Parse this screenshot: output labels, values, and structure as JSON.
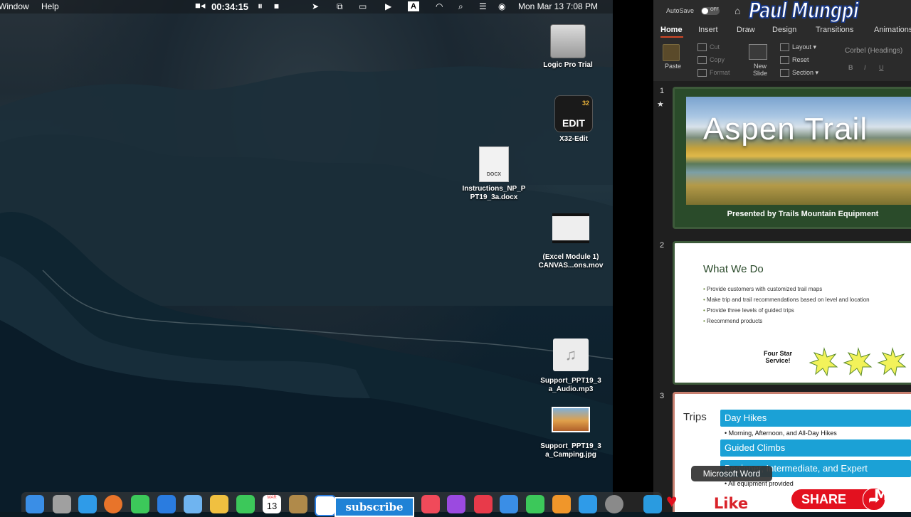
{
  "menubar": {
    "left_items": [
      "Window",
      "Help"
    ],
    "recording_time": "00:34:15",
    "datetime": "Mon Mar 13  7:08 PM",
    "input_indicator": "A"
  },
  "desktop_icons": [
    {
      "label": "Logic Pro Trial",
      "icon": "hard-drive-icon"
    },
    {
      "label": "X32-Edit",
      "icon": "x32-edit-app-icon",
      "art_text": "EDIT",
      "badge_text": "32"
    },
    {
      "label": "Instructions_NP_P\nPT19_3a.docx",
      "icon": "docx-file-icon",
      "art_text": "DOCX"
    },
    {
      "label": "(Excel Module 1)\nCANVAS...ons.mov",
      "icon": "movie-file-icon"
    },
    {
      "label": "Support_PPT19_3\na_Audio.mp3",
      "icon": "audio-file-icon"
    },
    {
      "label": "Support_PPT19_3\na_Camping.jpg",
      "icon": "image-file-icon"
    }
  ],
  "ppt": {
    "autosave_label": "AutoSave",
    "autosave_state": "OFF",
    "watermark": "Paul Mungpi",
    "tabs": [
      "Home",
      "Insert",
      "Draw",
      "Design",
      "Transitions",
      "Animations"
    ],
    "active_tab": "Home",
    "ribbon": {
      "paste": "Paste",
      "cut": "Cut",
      "copy": "Copy",
      "format": "Format",
      "new_slide": "New\nSlide",
      "layout": "Layout",
      "reset": "Reset",
      "section": "Section",
      "font": "Corbel (Headings)",
      "bold": "B",
      "italic": "I",
      "underline": "U"
    },
    "slides": [
      {
        "number": "1",
        "star": "★",
        "title": "Aspen Trail",
        "subtitle": "Presented by Trails Mountain Equipment"
      },
      {
        "number": "2",
        "title": "What We Do",
        "bullets": [
          "Provide customers with customized trail maps",
          "Make trip and trail recommendations based on level and location",
          "Provide three levels of guided trips",
          "Recommend products"
        ],
        "callout": "Four Star\nService!"
      },
      {
        "number": "3",
        "title": "Trips",
        "items": [
          "Day Hikes",
          "Guided Climbs",
          "Beginner, Intermediate, and Expert"
        ],
        "subitems": [
          "Morning, Afternoon, and All-Day Hikes",
          "All equipment provided"
        ]
      }
    ]
  },
  "dock": {
    "calendar_month": "MAR",
    "calendar_day": "13",
    "tooltip": "Microsoft Word",
    "subscribe": "subscribe",
    "like": "Like",
    "share": "SHARE",
    "mac": "MAC"
  },
  "colors": {
    "slide_border": "#3d5a3a",
    "slide_selected_border": "#c77f6f",
    "accent_blue": "#1ba1d6",
    "share_red": "#e3111f"
  }
}
